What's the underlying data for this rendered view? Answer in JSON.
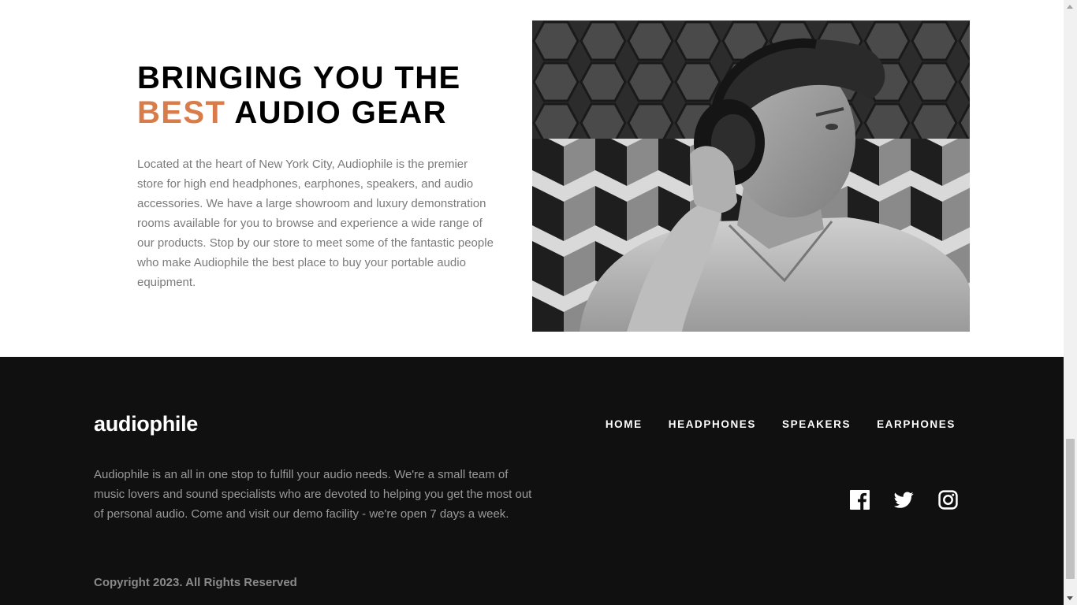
{
  "about": {
    "heading_line1": "Bringing you the",
    "heading_accent": "Best",
    "heading_rest": "audio gear",
    "body": "Located at the heart of New York City, Audiophile is the premier store for high end headphones, earphones, speakers, and audio accessories. We have a large showroom and luxury demonstration rooms available for you to browse and experience a wide range of our products. Stop by our store to meet some of the fantastic people who make Audiophile the best place to buy your portable audio equipment."
  },
  "footer": {
    "logo": "audiophile",
    "nav": [
      "Home",
      "Headphones",
      "Speakers",
      "Earphones"
    ],
    "description": "Audiophile is an all in one stop to fulfill your audio needs. We're a small team of music lovers and sound specialists who are devoted to helping you get the most out of personal audio. Come and visit our demo facility - we're open 7 days a week.",
    "copyright": "Copyright 2023. All Rights Reserved",
    "socials": [
      "facebook-icon",
      "twitter-icon",
      "instagram-icon"
    ]
  },
  "colors": {
    "accent": "#D87D4A",
    "footer_bg": "#101010"
  }
}
